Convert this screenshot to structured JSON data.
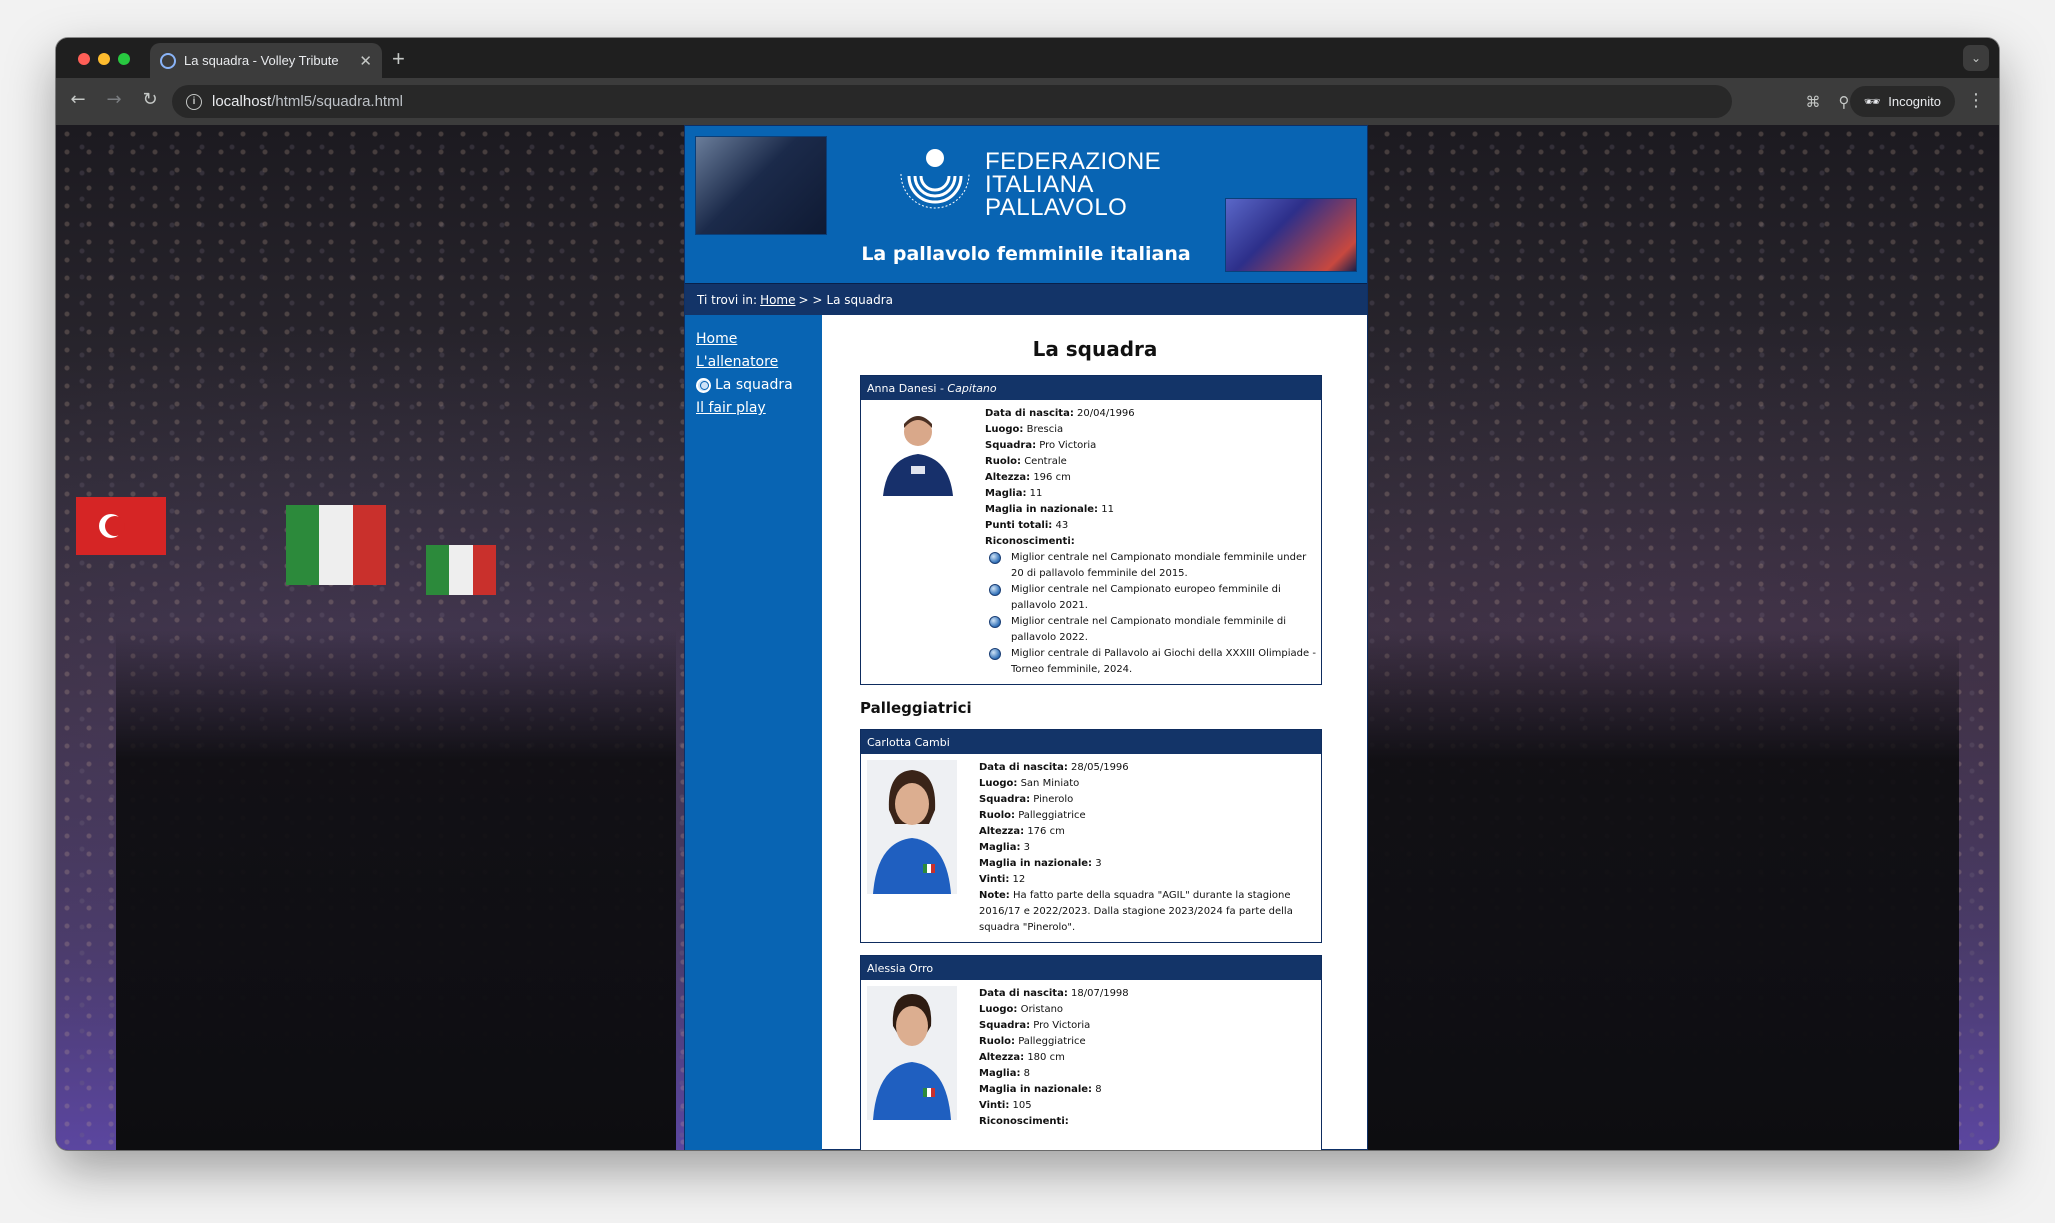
{
  "browser": {
    "tab_title": "La squadra - Volley Tribute",
    "url_host": "localhost",
    "url_path": "/html5/squadra.html",
    "profile_label": "Incognito"
  },
  "header": {
    "federation_line1": "FEDERAZIONE",
    "federation_line2": "ITALIANA",
    "federation_line3": "PALLAVOLO",
    "tagline": "La pallavolo femminile italiana"
  },
  "breadcrumb": {
    "prefix": "Ti trovi in:",
    "home": "Home",
    "separator": "> >",
    "current": "La squadra"
  },
  "sidebar": {
    "items": [
      {
        "label": "Home"
      },
      {
        "label": "L'allenatore"
      },
      {
        "label": "La squadra"
      },
      {
        "label": "Il fair play"
      }
    ]
  },
  "main": {
    "title": "La squadra",
    "section_setters": "Palleggiatrici"
  },
  "players": [
    {
      "name": "Anna Danesi",
      "role_tag": "Capitano",
      "fields": [
        {
          "label": "Data di nascita:",
          "value": "20/04/1996"
        },
        {
          "label": "Luogo:",
          "value": "Brescia"
        },
        {
          "label": "Squadra:",
          "value": "Pro Victoria"
        },
        {
          "label": "Ruolo:",
          "value": "Centrale"
        },
        {
          "label": "Altezza:",
          "value": "196 cm"
        },
        {
          "label": "Maglia:",
          "value": "11"
        },
        {
          "label": "Maglia in nazionale:",
          "value": "11"
        },
        {
          "label": "Punti totali:",
          "value": "43"
        }
      ],
      "awards_label": "Riconoscimenti:",
      "awards": [
        "Miglior centrale nel Campionato mondiale femminile under 20 di pallavolo femminile del 2015.",
        "Miglior centrale nel Campionato europeo femminile di pallavolo 2021.",
        "Miglior centrale nel Campionato mondiale femminile di pallavolo 2022.",
        "Miglior centrale di Pallavolo ai Giochi della XXXIII Olimpiade - Torneo femminile, 2024."
      ]
    },
    {
      "name": "Carlotta Cambi",
      "fields": [
        {
          "label": "Data di nascita:",
          "value": "28/05/1996"
        },
        {
          "label": "Luogo:",
          "value": "San Miniato"
        },
        {
          "label": "Squadra:",
          "value": "Pinerolo"
        },
        {
          "label": "Ruolo:",
          "value": "Palleggiatrice"
        },
        {
          "label": "Altezza:",
          "value": "176 cm"
        },
        {
          "label": "Maglia:",
          "value": "3"
        },
        {
          "label": "Maglia in nazionale:",
          "value": "3"
        },
        {
          "label": "Vinti:",
          "value": "12"
        },
        {
          "label": "Note:",
          "value": "Ha fatto parte della squadra \"AGIL\" durante la stagione 2016/17 e 2022/2023. Dalla stagione 2023/2024 fa parte della squadra \"Pinerolo\"."
        }
      ]
    },
    {
      "name": "Alessia Orro",
      "fields": [
        {
          "label": "Data di nascita:",
          "value": "18/07/1998"
        },
        {
          "label": "Luogo:",
          "value": "Oristano"
        },
        {
          "label": "Squadra:",
          "value": "Pro Victoria"
        },
        {
          "label": "Ruolo:",
          "value": "Palleggiatrice"
        },
        {
          "label": "Altezza:",
          "value": "180 cm"
        },
        {
          "label": "Maglia:",
          "value": "8"
        },
        {
          "label": "Maglia in nazionale:",
          "value": "8"
        },
        {
          "label": "Vinti:",
          "value": "105"
        },
        {
          "label": "Riconoscimenti:",
          "value": ""
        }
      ]
    }
  ],
  "colors": {
    "primary_blue": "#0864b3",
    "dark_navy": "#133468"
  }
}
